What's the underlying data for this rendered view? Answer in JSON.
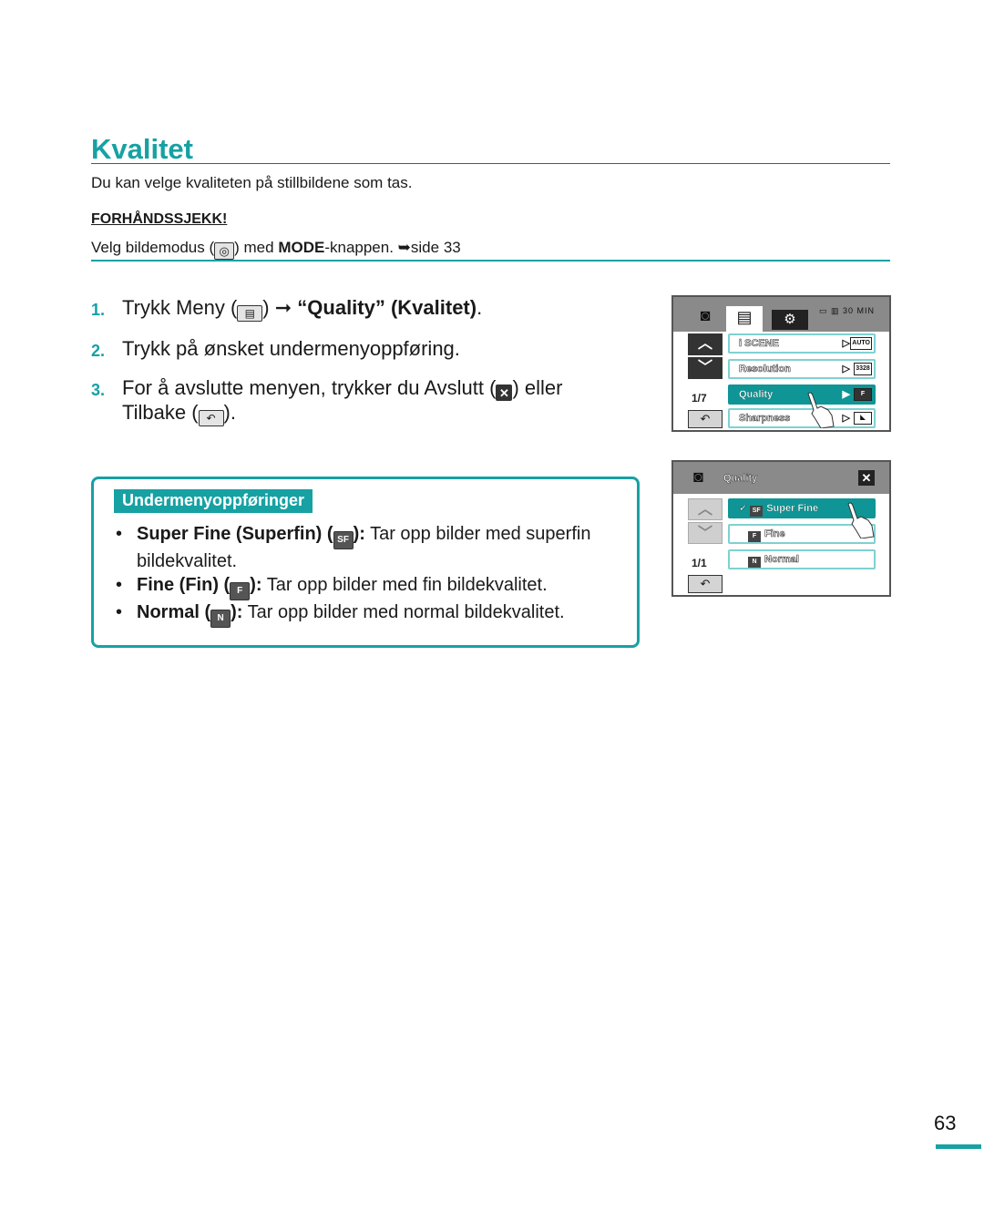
{
  "title": "Kvalitet",
  "intro": "Du kan velge kvaliteten på stillbildene som tas.",
  "precheck": {
    "heading": "FORHÅNDSSJEKK!",
    "text_before": "Velg bildemodus (",
    "camera_icon": "camera-icon",
    "text_mid": ") med ",
    "mode_bold": "MODE",
    "text_after": "-knappen. ➥side 33"
  },
  "steps": [
    {
      "num": "1.",
      "parts": {
        "a": "Trykk Meny (",
        "icon": "menu-icon",
        "b": ") ➞ ",
        "bold": "“Quality” (Kvalitet)",
        "c": "."
      }
    },
    {
      "num": "2.",
      "text": "Trykk på ønsket undermenyoppføring."
    },
    {
      "num": "3.",
      "parts": {
        "a": "For å avslutte menyen, trykker du Avslutt (",
        "icon": "close-icon",
        "b": ") eller",
        "c": "Tilbake (",
        "icon2": "back-icon",
        "d": ")."
      }
    }
  ],
  "submenu": {
    "heading": "Undermenyoppføringer",
    "items": [
      {
        "bold": "Super Fine (Superfin) (",
        "icon": "SF",
        "bold_end": "):",
        "text": " Tar opp bilder med superfin bildekvalitet."
      },
      {
        "bold": "Fine (Fin) (",
        "icon": "F",
        "bold_end": "):",
        "text": " Tar opp bilder med fin bildekvalitet."
      },
      {
        "bold": "Normal  (",
        "icon": "N",
        "bold_end": "):",
        "text": " Tar opp bilder med normal bildekvalitet."
      }
    ]
  },
  "screen1": {
    "tabs": [
      "camera-icon",
      "menu-icon",
      "gear-icon"
    ],
    "status": "▭ ▥ 30 MIN",
    "pager": "1/7",
    "rows": [
      {
        "label": "i SCENE",
        "value": "AUTO",
        "selected": false
      },
      {
        "label": "Resolution",
        "value": "3328",
        "selected": false
      },
      {
        "label": "Quality",
        "value": "F",
        "selected": true
      },
      {
        "label": "Sharpness",
        "value": "◣",
        "selected": false
      }
    ]
  },
  "screen2": {
    "title": "Quality",
    "pager": "1/1",
    "rows": [
      {
        "check": "✔",
        "icon": "SF",
        "label": "Super Fine",
        "selected": true
      },
      {
        "check": "",
        "icon": "F",
        "label": "Fine",
        "selected": false
      },
      {
        "check": "",
        "icon": "N",
        "label": "Normal",
        "selected": false
      }
    ]
  },
  "page_number": "63",
  "colors": {
    "accent": "#17a1a3",
    "selected_row": "#0f9595",
    "screen_header": "#8a8a8a"
  }
}
